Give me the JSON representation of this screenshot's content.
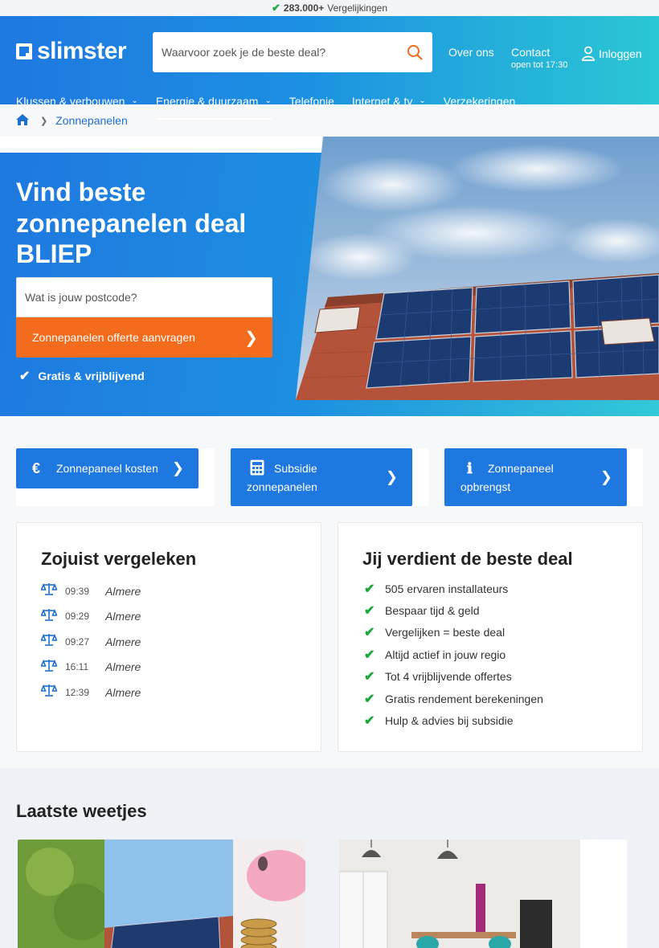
{
  "topbar": {
    "count": "283.000+",
    "label": "Vergelijkingen"
  },
  "header": {
    "logo": "slimster",
    "search_placeholder": "Waarvoor zoek je de beste deal?",
    "about": "Over ons",
    "contact": "Contact",
    "contact_hours": "open tot 17:30",
    "login": "Inloggen"
  },
  "nav": {
    "items": [
      {
        "label": "Klussen & verbouwen",
        "dropdown": true
      },
      {
        "label": "Energie & duurzaam",
        "dropdown": true,
        "active": true
      },
      {
        "label": "Telefonie",
        "dropdown": false
      },
      {
        "label": "Internet & tv",
        "dropdown": true
      },
      {
        "label": "Verzekeringen",
        "dropdown": false
      }
    ]
  },
  "breadcrumb": {
    "home_icon": "home-icon",
    "current": "Zonnepanelen"
  },
  "hero": {
    "title": "Vind beste zonnepanelen deal BLIEP",
    "postcode_placeholder": "Wat is jouw postcode?",
    "cta": "Zonnepanelen offerte aanvragen",
    "free": "Gratis & vrijblijvend"
  },
  "quick_links": [
    {
      "icon": "euro-icon",
      "label": "Zonnepaneel kosten"
    },
    {
      "icon": "calculator-icon",
      "label": "Subsidie zonnepanelen"
    },
    {
      "icon": "info-icon",
      "label": "Zonnepaneel opbrengst"
    }
  ],
  "recent": {
    "title": "Zojuist vergeleken",
    "rows": [
      {
        "time": "09:39",
        "city": "Almere"
      },
      {
        "time": "09:29",
        "city": "Almere"
      },
      {
        "time": "09:27",
        "city": "Almere"
      },
      {
        "time": "16:11",
        "city": "Almere"
      },
      {
        "time": "12:39",
        "city": "Almere"
      }
    ]
  },
  "benefits": {
    "title": "Jij verdient de beste deal",
    "items": [
      "505 ervaren installateurs",
      "Bespaar tijd & geld",
      "Vergelijken = beste deal",
      "Altijd actief in jouw regio",
      "Tot 4 vrijblijvende offertes",
      "Gratis rendement berekeningen",
      "Hulp & advies bij subsidie"
    ]
  },
  "news": {
    "title": "Laatste weetjes"
  },
  "colors": {
    "primary": "#1f78e0",
    "accent": "#f36b1c",
    "check": "#1aa83a"
  }
}
